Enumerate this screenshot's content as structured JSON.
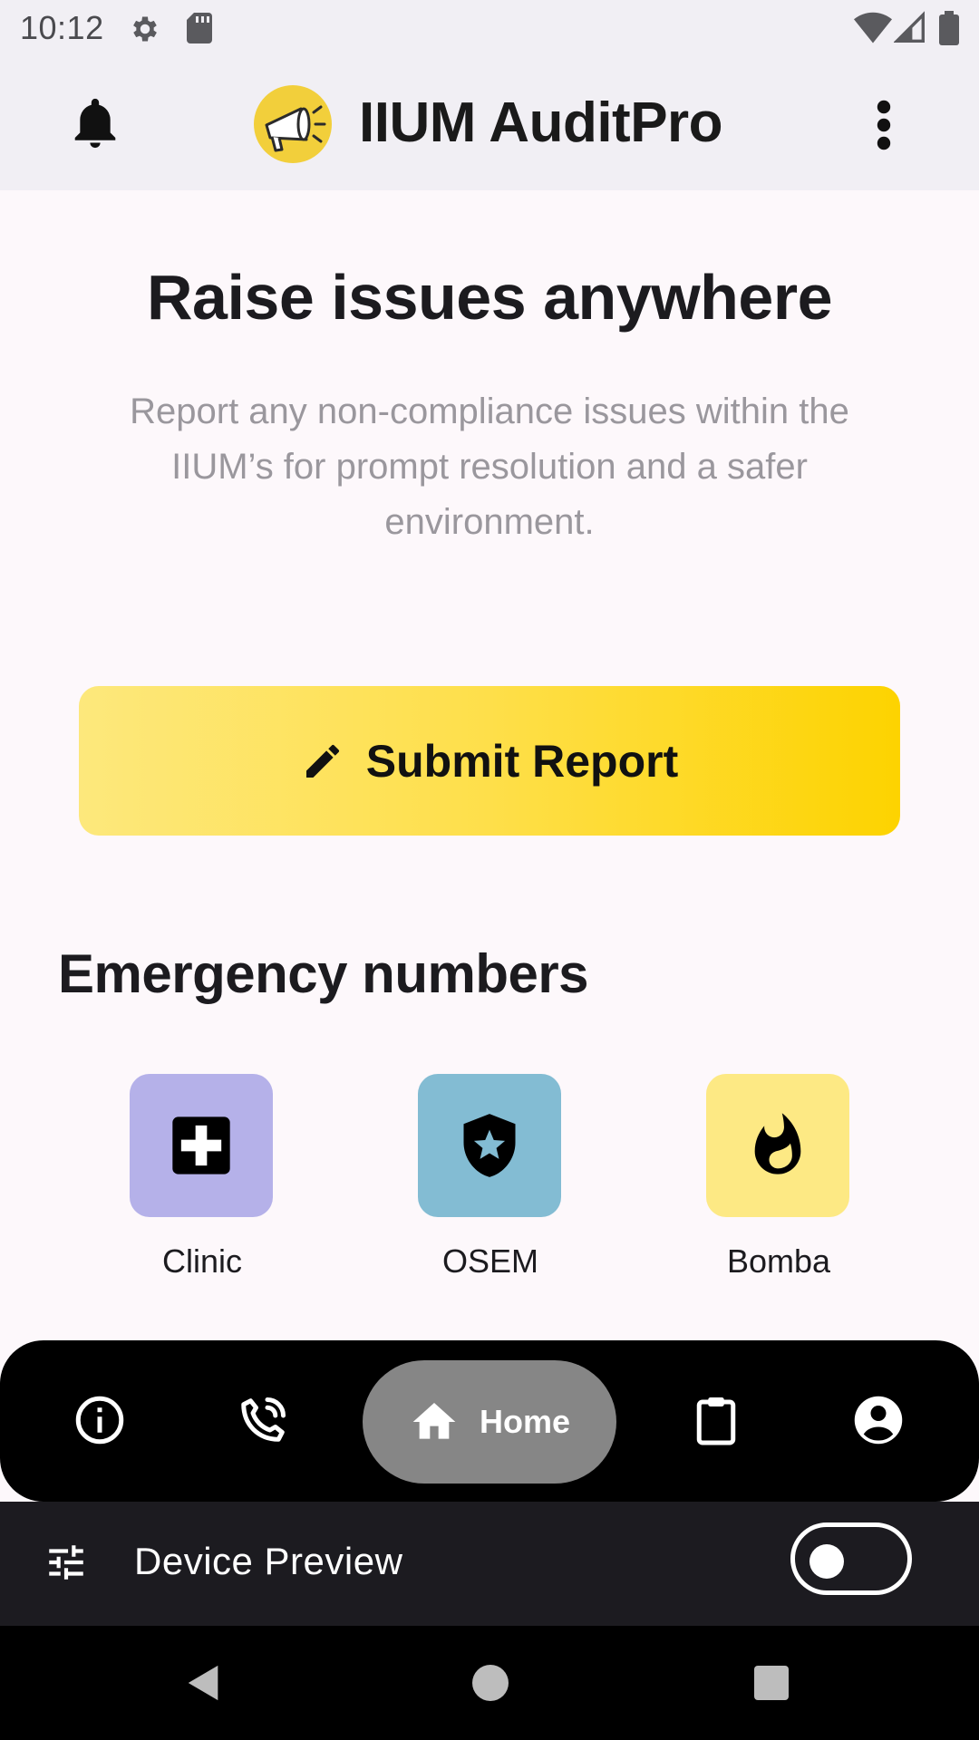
{
  "status_bar": {
    "time": "10:12",
    "icons": [
      "gear-icon",
      "sd-card-icon",
      "wifi-icon",
      "signal-icon",
      "battery-icon"
    ]
  },
  "app_bar": {
    "title": "IIUM AuditPro",
    "left_icon": "bell-icon",
    "logo_icon": "megaphone-icon",
    "right_icon": "more-vert-icon",
    "logo_color": "#f2cf3b"
  },
  "hero": {
    "headline": "Raise issues anywhere",
    "subtext": "Report any non-compliance issues within the IIUM’s for prompt resolution and a safer environment."
  },
  "submit_button": {
    "label": "Submit Report",
    "icon": "pencil-icon",
    "gradient_start": "#fde87c",
    "gradient_end": "#fdd300"
  },
  "emergency": {
    "title": "Emergency numbers",
    "items": [
      {
        "label": "Clinic",
        "icon": "medical-cross-icon",
        "color": "#b5b1e9"
      },
      {
        "label": "OSEM",
        "icon": "shield-star-icon",
        "color": "#83bcd3"
      },
      {
        "label": "Bomba",
        "icon": "fire-icon",
        "color": "#fde984"
      }
    ]
  },
  "bottom_nav": {
    "items": [
      {
        "name": "info",
        "icon": "info-icon"
      },
      {
        "name": "call",
        "icon": "phone-icon"
      },
      {
        "name": "home",
        "icon": "home-icon",
        "label": "Home",
        "selected": true
      },
      {
        "name": "reports",
        "icon": "clipboard-icon"
      },
      {
        "name": "profile",
        "icon": "account-icon"
      }
    ]
  },
  "device_preview": {
    "label": "Device Preview",
    "icon": "tune-icon",
    "toggle_on": false
  },
  "system_nav": {
    "icons": [
      "back-icon",
      "home-circle-icon",
      "recents-icon"
    ]
  }
}
